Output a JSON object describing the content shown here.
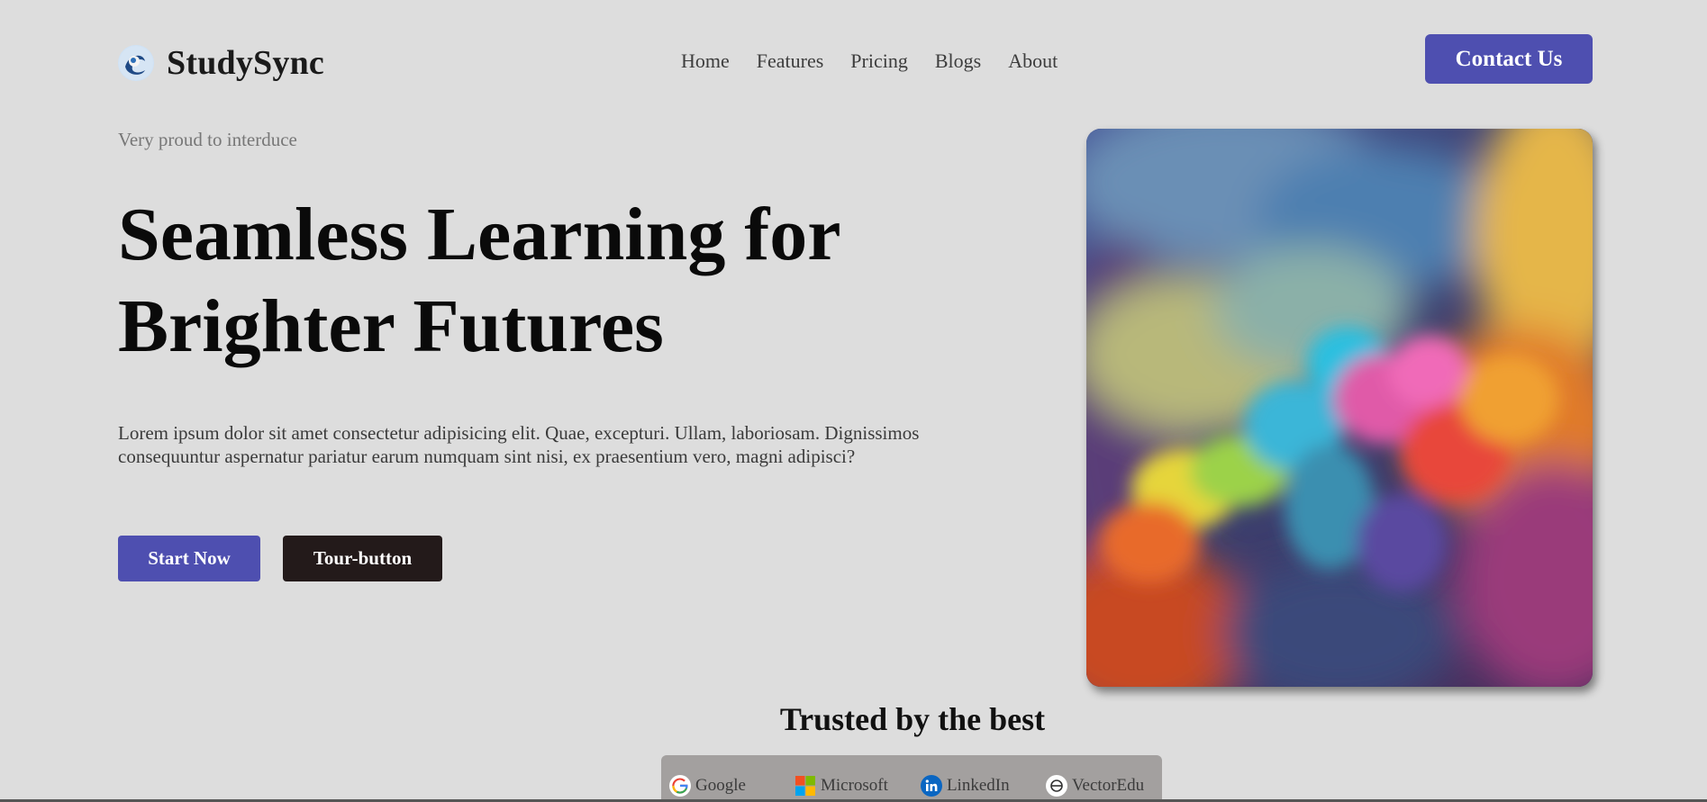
{
  "brand": {
    "name": "StudySync"
  },
  "nav": {
    "items": [
      "Home",
      "Features",
      "Pricing",
      "Blogs",
      "About"
    ]
  },
  "header": {
    "contact_label": "Contact Us"
  },
  "hero": {
    "eyebrow": "Very proud to interduce",
    "headline_line1": "Seamless Learning for",
    "headline_line2": "Brighter Futures",
    "lead": "Lorem ipsum dolor sit amet consectetur adipisicing elit. Quae, excepturi. Ullam, laboriosam. Dignissimos consequuntur aspernatur pariatur earum numquam sint nisi, ex praesentium vero, magni adipisci?",
    "primary_button": "Start Now",
    "secondary_button": "Tour-button"
  },
  "trusted": {
    "title": "Trusted by the best",
    "logos": [
      {
        "name": "Google",
        "icon": "google-icon"
      },
      {
        "name": "Microsoft",
        "icon": "microsoft-icon"
      },
      {
        "name": "LinkedIn",
        "icon": "linkedin-icon"
      },
      {
        "name": "VectorEdu",
        "icon": "vectoredu-icon"
      }
    ]
  },
  "colors": {
    "background": "#dddddd",
    "accent": "#4e4fb0",
    "dark_button": "#231a1a",
    "logos_bar": "#a3a09f"
  }
}
